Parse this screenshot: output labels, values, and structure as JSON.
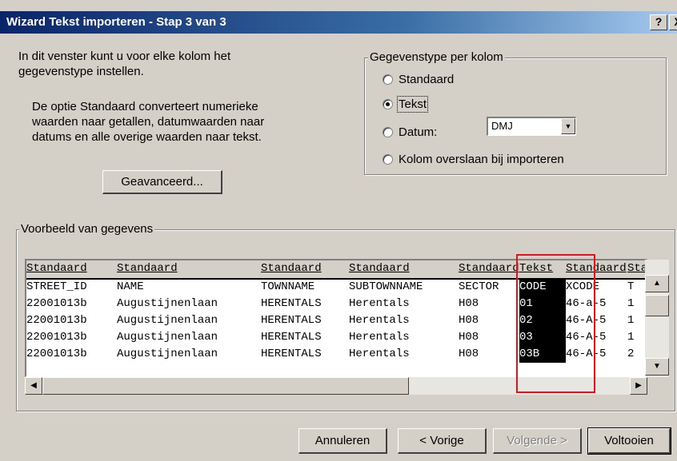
{
  "window": {
    "title": "Wizard Tekst importeren - Stap 3 van 3",
    "help_label": "?",
    "close_label": "X"
  },
  "intro": {
    "line1": "In dit venster kunt u voor elke kolom het",
    "line2": "gegevenstype instellen.",
    "desc1": "De optie Standaard converteert numerieke",
    "desc2": "waarden naar getallen, datumwaarden naar",
    "desc3": "datums en alle overige waarden naar tekst."
  },
  "advanced_button": "Geavanceerd...",
  "column_type_group": {
    "label": "Gegevenstype per kolom",
    "options": [
      "Standaard",
      "Tekst",
      "Datum:",
      "Kolom overslaan bij importeren"
    ],
    "selected": "Tekst",
    "date_format": "DMJ"
  },
  "preview": {
    "label": "Voorbeeld van gegevens",
    "headers": [
      "Standaard",
      "Standaard",
      "Standaard",
      "Standaard",
      "Standaard",
      "Tekst",
      "Standaard",
      "Standaard"
    ],
    "rows": [
      [
        "STREET_ID",
        "NAME",
        "TOWNNAME",
        "SUBTOWNNAME",
        "SECTOR",
        "CODE",
        "XCODE",
        "T"
      ],
      [
        "22001013b",
        "Augustijnenlaan",
        "HERENTALS",
        "Herentals",
        "H08",
        "01",
        "46-a-5",
        "1"
      ],
      [
        "22001013b",
        "Augustijnenlaan",
        "HERENTALS",
        "Herentals",
        "H08",
        "02",
        "46-A-5",
        "1"
      ],
      [
        "22001013b",
        "Augustijnenlaan",
        "HERENTALS",
        "Herentals",
        "H08",
        "03",
        "46-A-5",
        "1"
      ],
      [
        "22001013b",
        "Augustijnenlaan",
        "HERENTALS",
        "Herentals",
        "H08",
        "03B",
        "46-A-5",
        "2"
      ]
    ],
    "selected_column": 5
  },
  "buttons": {
    "cancel": "Annuleren",
    "back": "< Vorige",
    "next": "Volgende >",
    "finish": "Voltooien"
  },
  "colors": {
    "dialog_bg": "#d4d0c8",
    "title_bar": "#0a246a",
    "highlight": "#e8101a"
  }
}
